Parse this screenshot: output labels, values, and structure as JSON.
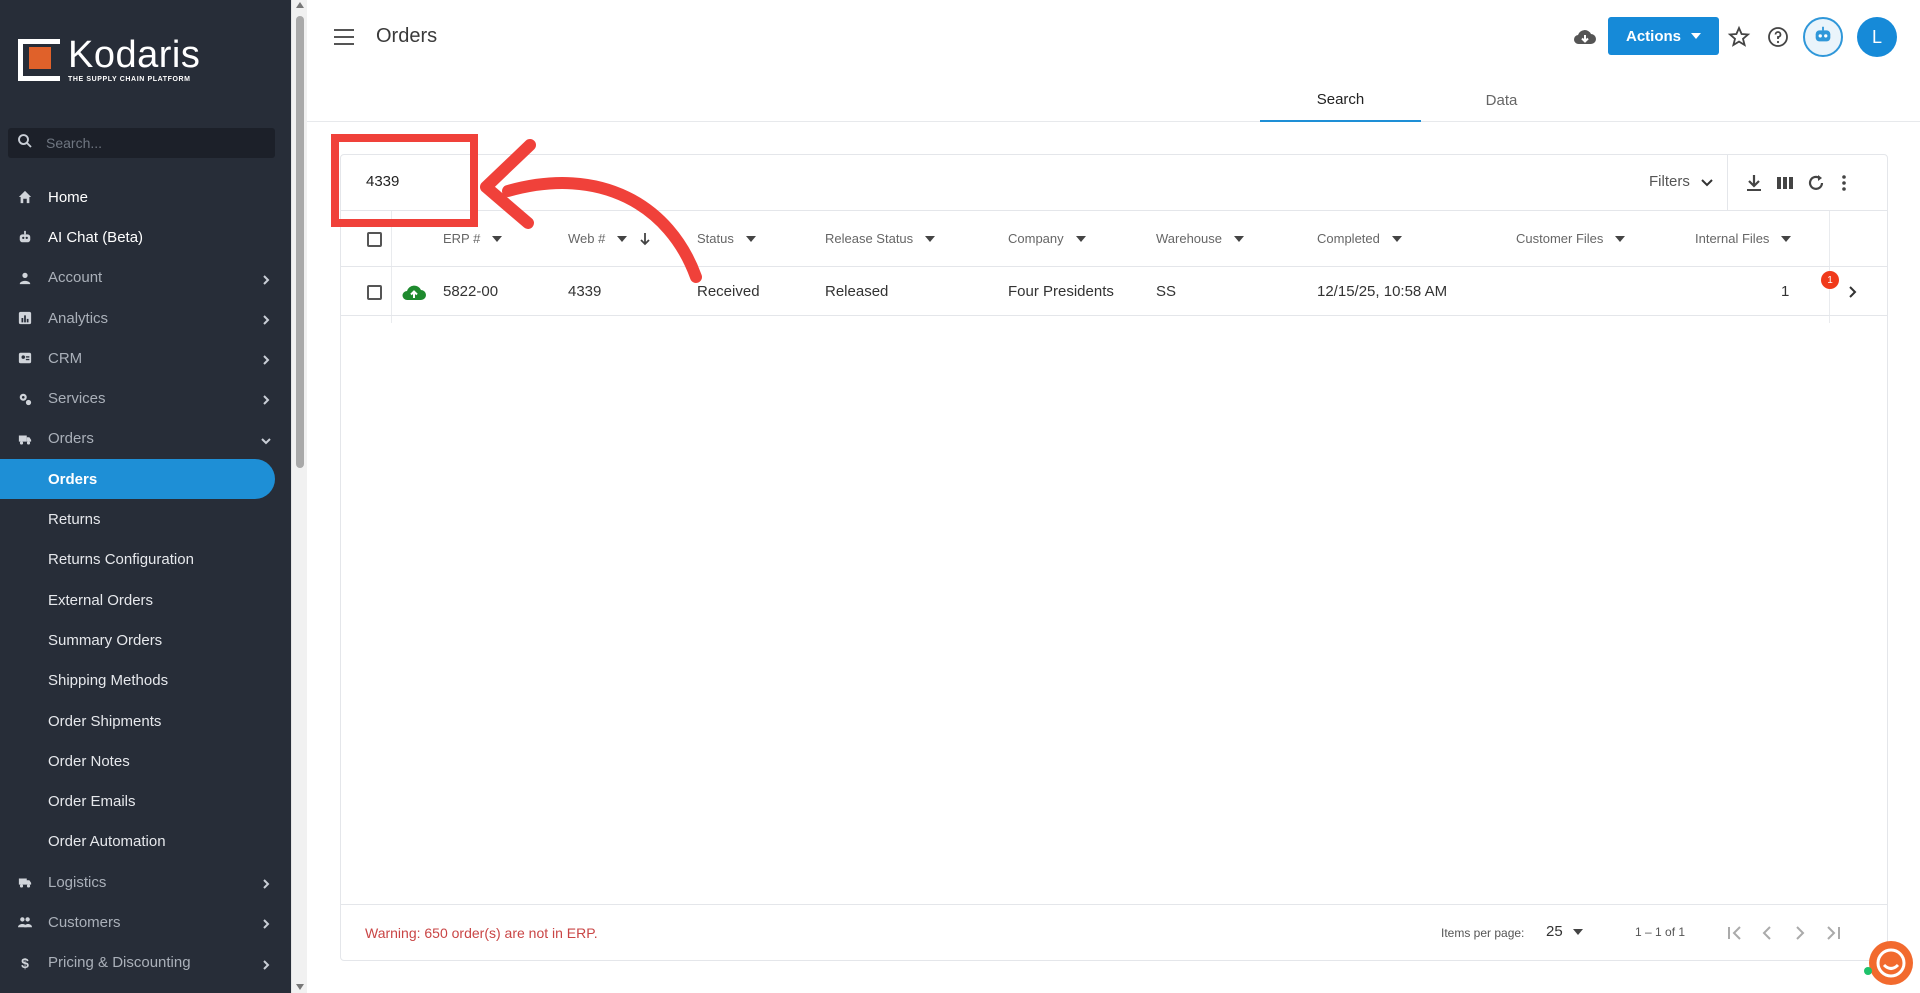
{
  "brand": {
    "name": "Kodaris",
    "tagline": "THE SUPPLY CHAIN PLATFORM"
  },
  "sidebar": {
    "search_placeholder": "Search...",
    "items": [
      {
        "label": "Home",
        "icon": "home-icon"
      },
      {
        "label": "AI Chat (Beta)",
        "icon": "robot-icon"
      },
      {
        "label": "Account",
        "icon": "person-icon"
      },
      {
        "label": "Analytics",
        "icon": "chart-icon"
      },
      {
        "label": "CRM",
        "icon": "contact-card-icon"
      },
      {
        "label": "Services",
        "icon": "gears-icon"
      },
      {
        "label": "Orders",
        "icon": "truck-icon"
      }
    ],
    "order_sub": [
      "Orders",
      "Returns",
      "Returns Configuration",
      "External Orders",
      "Summary Orders",
      "Shipping Methods",
      "Order Shipments",
      "Order Notes",
      "Order Emails",
      "Order Automation"
    ],
    "bottom_items": [
      {
        "label": "Logistics",
        "icon": "van-icon"
      },
      {
        "label": "Customers",
        "icon": "group-icon"
      },
      {
        "label": "Pricing & Discounting",
        "icon": "dollar-icon"
      }
    ]
  },
  "header": {
    "title": "Orders",
    "actions_label": "Actions",
    "avatar_letter": "L",
    "tabs": [
      "Search",
      "Data"
    ],
    "active_tab": "Search"
  },
  "toolbar": {
    "search_value": "4339",
    "filters_label": "Filters"
  },
  "table": {
    "columns": [
      "ERP #",
      "Web #",
      "Status",
      "Release Status",
      "Company",
      "Warehouse",
      "Completed",
      "Customer Files",
      "Internal Files"
    ],
    "rows": [
      {
        "erp": "5822-00",
        "web": "4339",
        "status": "Received",
        "release_status": "Released",
        "company": "Four Presidents",
        "warehouse": "SS",
        "completed": "12/15/25, 10:58 AM",
        "customer_files": "",
        "internal_files": "1",
        "badge": "1"
      }
    ]
  },
  "footer": {
    "warning": "Warning: 650 order(s) are not in ERP.",
    "items_per_page_label": "Items per page:",
    "items_per_page": "25",
    "range": "1 – 1 of 1"
  },
  "colors": {
    "sidebar_bg": "#272d38",
    "accent": "#1e8fd6",
    "warning": "#c94545",
    "annotation": "#f0413a",
    "upload_green": "#1e8a2e"
  }
}
